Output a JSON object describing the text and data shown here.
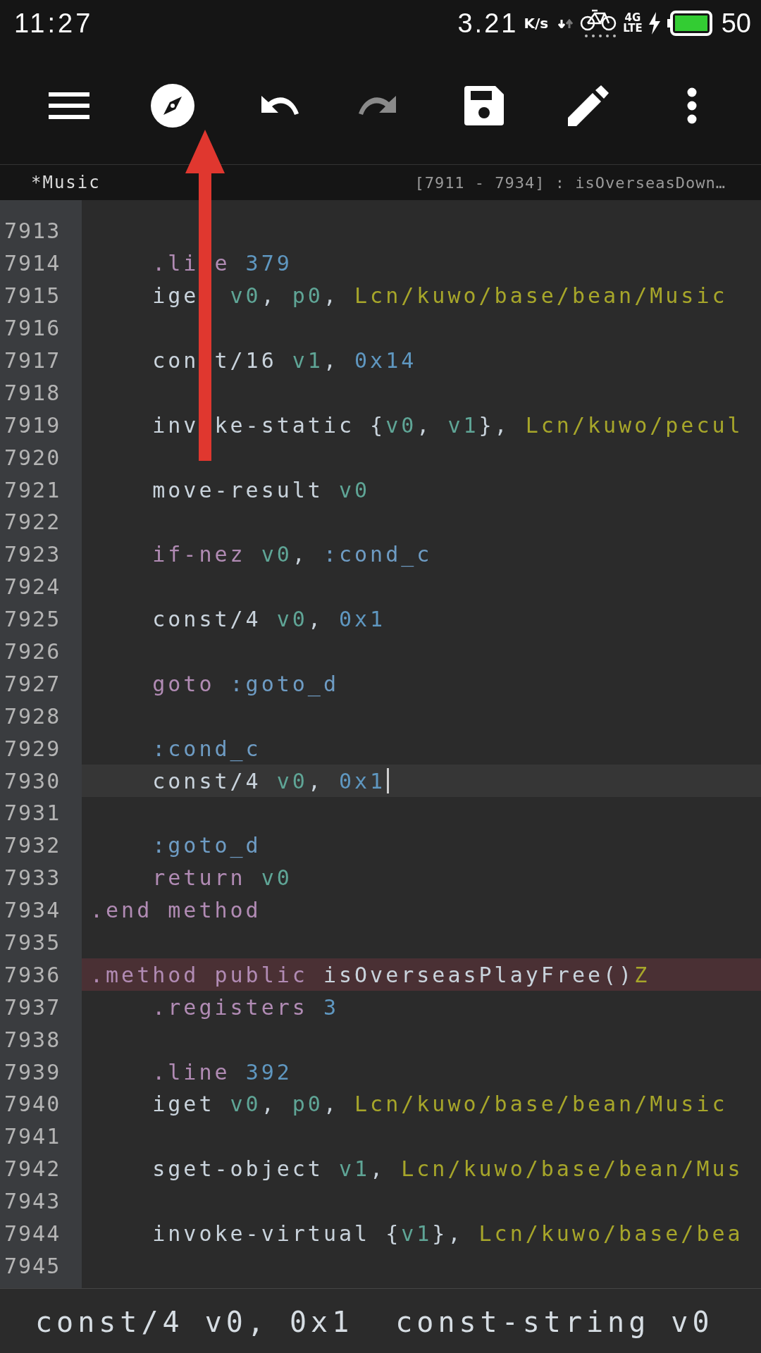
{
  "status_bar": {
    "time": "11:27",
    "speed": "3.21",
    "speed_unit": "K/s",
    "network": "4G",
    "network_sub": "LTE",
    "battery": "50"
  },
  "toolbar": [
    {
      "kind": "menu",
      "disabled": false
    },
    {
      "kind": "navigate",
      "disabled": false
    },
    {
      "kind": "undo",
      "disabled": false
    },
    {
      "kind": "redo",
      "disabled": true
    },
    {
      "kind": "save",
      "disabled": false
    },
    {
      "kind": "edit",
      "disabled": false
    },
    {
      "kind": "more",
      "disabled": false
    }
  ],
  "tab_bar": {
    "file": "*Music",
    "location": "[7911 - 7934] : isOverseasDown…"
  },
  "lines": [
    {
      "number": "7913",
      "current": false,
      "flagged": false
    },
    {
      "number": "7914",
      "current": false,
      "flagged": false,
      "tokens": [
        {
          "kind": "directive",
          "text": "    .li"
        },
        {
          "kind": "directive",
          "text": "e ",
          "gap_before": true
        },
        {
          "kind": "number",
          "text": "379"
        }
      ]
    },
    {
      "number": "7915",
      "current": false,
      "flagged": false,
      "tokens": [
        {
          "kind": "plain",
          "text": "    ige"
        },
        {
          "kind": "register",
          "text": " v0",
          "gap_before": true
        },
        {
          "kind": "plain",
          "text": ", "
        },
        {
          "kind": "register",
          "text": "p0"
        },
        {
          "kind": "plain",
          "text": ", "
        },
        {
          "kind": "type",
          "text": "Lcn/kuwo/base/bean/Music"
        }
      ]
    },
    {
      "number": "7916",
      "current": false,
      "flagged": false
    },
    {
      "number": "7917",
      "current": false,
      "flagged": false,
      "tokens": [
        {
          "kind": "plain",
          "text": "    con"
        },
        {
          "kind": "plain",
          "text": "t/16 ",
          "gap_before": true
        },
        {
          "kind": "register",
          "text": "v1"
        },
        {
          "kind": "plain",
          "text": ", "
        },
        {
          "kind": "number",
          "text": "0x14"
        }
      ]
    },
    {
      "number": "7918",
      "current": false,
      "flagged": false
    },
    {
      "number": "7919",
      "current": false,
      "flagged": false,
      "tokens": [
        {
          "kind": "plain",
          "text": "    inv"
        },
        {
          "kind": "plain",
          "text": "ke-static {",
          "gap_before": true
        },
        {
          "kind": "register",
          "text": "v0"
        },
        {
          "kind": "plain",
          "text": ", "
        },
        {
          "kind": "register",
          "text": "v1"
        },
        {
          "kind": "plain",
          "text": "}, "
        },
        {
          "kind": "type",
          "text": "Lcn/kuwo/pecul"
        }
      ]
    },
    {
      "number": "7920",
      "current": false,
      "flagged": false
    },
    {
      "number": "7921",
      "current": false,
      "flagged": false,
      "tokens": [
        {
          "kind": "plain",
          "text": "    move-result "
        },
        {
          "kind": "register",
          "text": "v0"
        }
      ]
    },
    {
      "number": "7922",
      "current": false,
      "flagged": false
    },
    {
      "number": "7923",
      "current": false,
      "flagged": false,
      "tokens": [
        {
          "kind": "directive",
          "text": "    if-nez "
        },
        {
          "kind": "register",
          "text": "v0"
        },
        {
          "kind": "plain",
          "text": ", "
        },
        {
          "kind": "label",
          "text": ":cond_c"
        }
      ]
    },
    {
      "number": "7924",
      "current": false,
      "flagged": false
    },
    {
      "number": "7925",
      "current": false,
      "flagged": false,
      "tokens": [
        {
          "kind": "plain",
          "text": "    const/4 "
        },
        {
          "kind": "register",
          "text": "v0"
        },
        {
          "kind": "plain",
          "text": ", "
        },
        {
          "kind": "number",
          "text": "0x1"
        }
      ]
    },
    {
      "number": "7926",
      "current": false,
      "flagged": false
    },
    {
      "number": "7927",
      "current": false,
      "flagged": false,
      "tokens": [
        {
          "kind": "directive",
          "text": "    goto "
        },
        {
          "kind": "label",
          "text": ":goto_d"
        }
      ]
    },
    {
      "number": "7928",
      "current": false,
      "flagged": false
    },
    {
      "number": "7929",
      "current": false,
      "flagged": false,
      "tokens": [
        {
          "kind": "label",
          "text": "    :cond_c"
        }
      ]
    },
    {
      "number": "7930",
      "current": true,
      "flagged": false,
      "tokens": [
        {
          "kind": "plain",
          "text": "    const/4 "
        },
        {
          "kind": "register",
          "text": "v0"
        },
        {
          "kind": "plain",
          "text": ", "
        },
        {
          "kind": "number",
          "text": "0x1"
        }
      ]
    },
    {
      "number": "7931",
      "current": false,
      "flagged": false
    },
    {
      "number": "7932",
      "current": false,
      "flagged": false,
      "tokens": [
        {
          "kind": "label",
          "text": "    :goto_d"
        }
      ]
    },
    {
      "number": "7933",
      "current": false,
      "flagged": false,
      "tokens": [
        {
          "kind": "directive",
          "text": "    return "
        },
        {
          "kind": "register",
          "text": "v0"
        }
      ]
    },
    {
      "number": "7934",
      "current": false,
      "flagged": false,
      "tokens": [
        {
          "kind": "directive",
          "text": ".end method"
        }
      ]
    },
    {
      "number": "7935",
      "current": false,
      "flagged": false
    },
    {
      "number": "7936",
      "current": false,
      "flagged": true,
      "tokens": [
        {
          "kind": "directive",
          "text": ".method public "
        },
        {
          "kind": "plain",
          "text": "isOverseasPlayFree()"
        },
        {
          "kind": "type",
          "text": "Z"
        }
      ]
    },
    {
      "number": "7937",
      "current": false,
      "flagged": false,
      "tokens": [
        {
          "kind": "directive",
          "text": "    .registers "
        },
        {
          "kind": "number",
          "text": "3"
        }
      ]
    },
    {
      "number": "7938",
      "current": false,
      "flagged": false
    },
    {
      "number": "7939",
      "current": false,
      "flagged": false,
      "tokens": [
        {
          "kind": "directive",
          "text": "    .line "
        },
        {
          "kind": "number",
          "text": "392"
        }
      ]
    },
    {
      "number": "7940",
      "current": false,
      "flagged": false,
      "tokens": [
        {
          "kind": "plain",
          "text": "    iget "
        },
        {
          "kind": "register",
          "text": "v0"
        },
        {
          "kind": "plain",
          "text": ", "
        },
        {
          "kind": "register",
          "text": "p0"
        },
        {
          "kind": "plain",
          "text": ", "
        },
        {
          "kind": "type",
          "text": "Lcn/kuwo/base/bean/Music"
        }
      ]
    },
    {
      "number": "7941",
      "current": false,
      "flagged": false
    },
    {
      "number": "7942",
      "current": false,
      "flagged": false,
      "tokens": [
        {
          "kind": "plain",
          "text": "    sget-object "
        },
        {
          "kind": "register",
          "text": "v1"
        },
        {
          "kind": "plain",
          "text": ", "
        },
        {
          "kind": "type",
          "text": "Lcn/kuwo/base/bean/Mus"
        }
      ]
    },
    {
      "number": "7943",
      "current": false,
      "flagged": false
    },
    {
      "number": "7944",
      "current": false,
      "flagged": false,
      "tokens": [
        {
          "kind": "plain",
          "text": "    invoke-virtual {"
        },
        {
          "kind": "register",
          "text": "v1"
        },
        {
          "kind": "plain",
          "text": "}, "
        },
        {
          "kind": "type",
          "text": "Lcn/kuwo/base/bea"
        }
      ]
    },
    {
      "number": "7945",
      "current": false,
      "flagged": false
    }
  ],
  "suggestions": [
    "const/4 v0, 0x1",
    "const-string v0"
  ]
}
